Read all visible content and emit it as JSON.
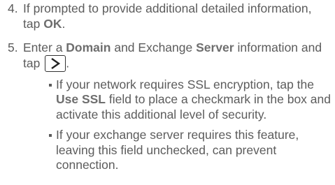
{
  "step4": {
    "number": "4.",
    "text_before": "If prompted to provide additional detailed information, tap ",
    "ok_label": "OK",
    "text_after": "."
  },
  "step5": {
    "number": "5.",
    "text_1": "Enter a ",
    "domain_label": "Domain",
    "text_2": " and Exchange ",
    "server_label": "Server",
    "text_3": " information and tap ",
    "next_icon": "chevron-right-icon",
    "text_4": ".",
    "bullets": [
      {
        "text_1": "If your network requires SSL encryption, tap the ",
        "use_ssl_label": "Use SSL",
        "text_2": " field to place a checkmark in the box and activate this additional level of security."
      },
      {
        "text_1": "If your exchange server requires this feature, leaving this field unchecked, can prevent connection."
      }
    ]
  }
}
